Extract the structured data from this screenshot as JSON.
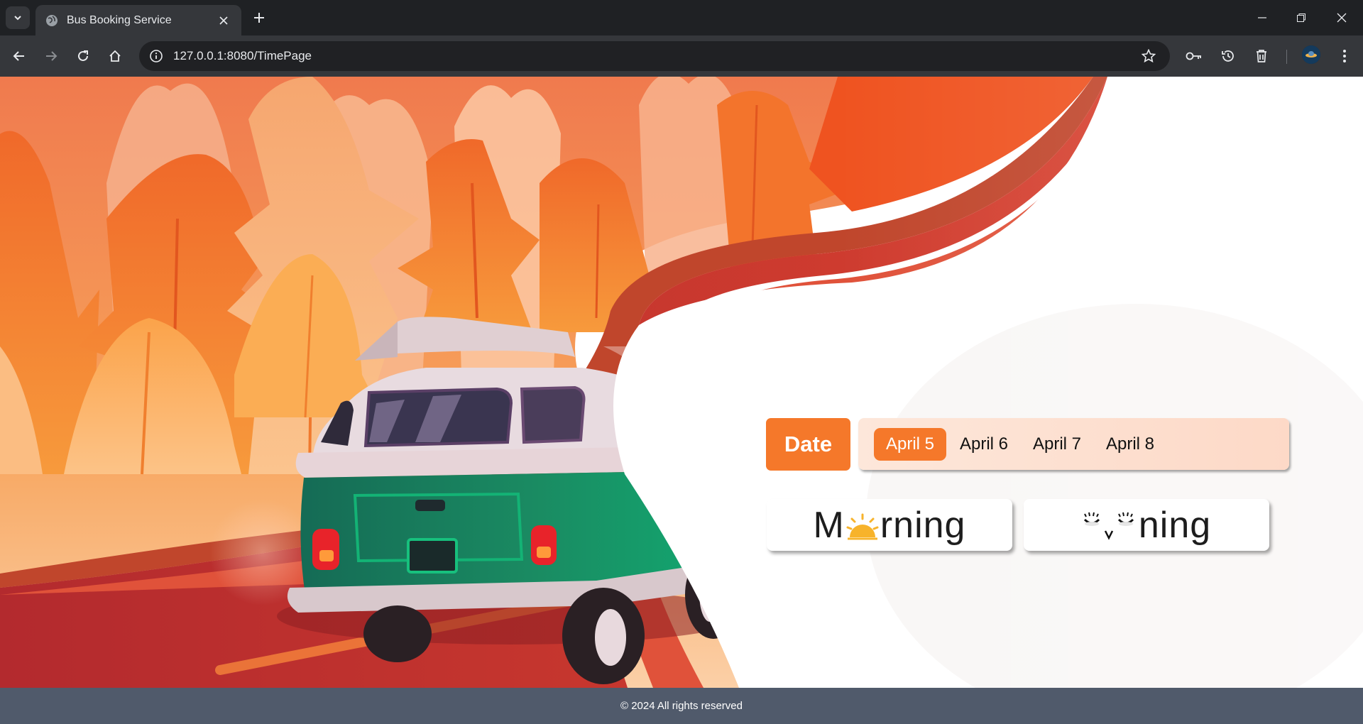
{
  "browser": {
    "tab_title": "Bus Booking Service",
    "url": "127.0.0.1:8080/TimePage"
  },
  "booking": {
    "date_label": "Date",
    "dates": [
      {
        "label": "April 5",
        "selected": true
      },
      {
        "label": "April 6",
        "selected": false
      },
      {
        "label": "April 7",
        "selected": false
      },
      {
        "label": "April 8",
        "selected": false
      }
    ],
    "periods": {
      "morning": {
        "prefix": "M",
        "suffix": "rning",
        "icon": "rising-sun-icon"
      },
      "evening": {
        "suffix": "ning",
        "icon": "sleepy-eyes-icon"
      }
    }
  },
  "footer": {
    "text": "© 2024 All rights reserved"
  },
  "colors": {
    "accent": "#f5782a",
    "footer_bg": "#505a6b",
    "van_green": "#12a36b",
    "road": "#c7332c"
  }
}
